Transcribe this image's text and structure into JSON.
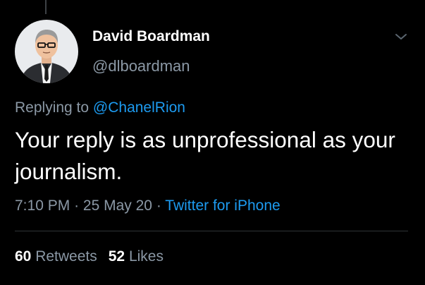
{
  "tweet": {
    "author": {
      "display_name": "David Boardman",
      "handle": "@dlboardman",
      "avatar_icon": "user-avatar-illustration"
    },
    "replying_to_prefix": "Replying to ",
    "replying_to_handle": "@ChanelRion",
    "text": "Your reply is as unprofessional as your journalism.",
    "time": "7:10 PM",
    "date": "25 May 20",
    "separator": "·",
    "source": "Twitter for iPhone",
    "retweets_count": "60",
    "retweets_label": "Retweets",
    "likes_count": "52",
    "likes_label": "Likes",
    "menu_icon": "chevron-down-icon"
  },
  "colors": {
    "background": "#000000",
    "primary_text": "#ffffff",
    "secondary_text": "#8b98a5",
    "accent": "#1d9bf0",
    "divider": "#2f3336"
  }
}
